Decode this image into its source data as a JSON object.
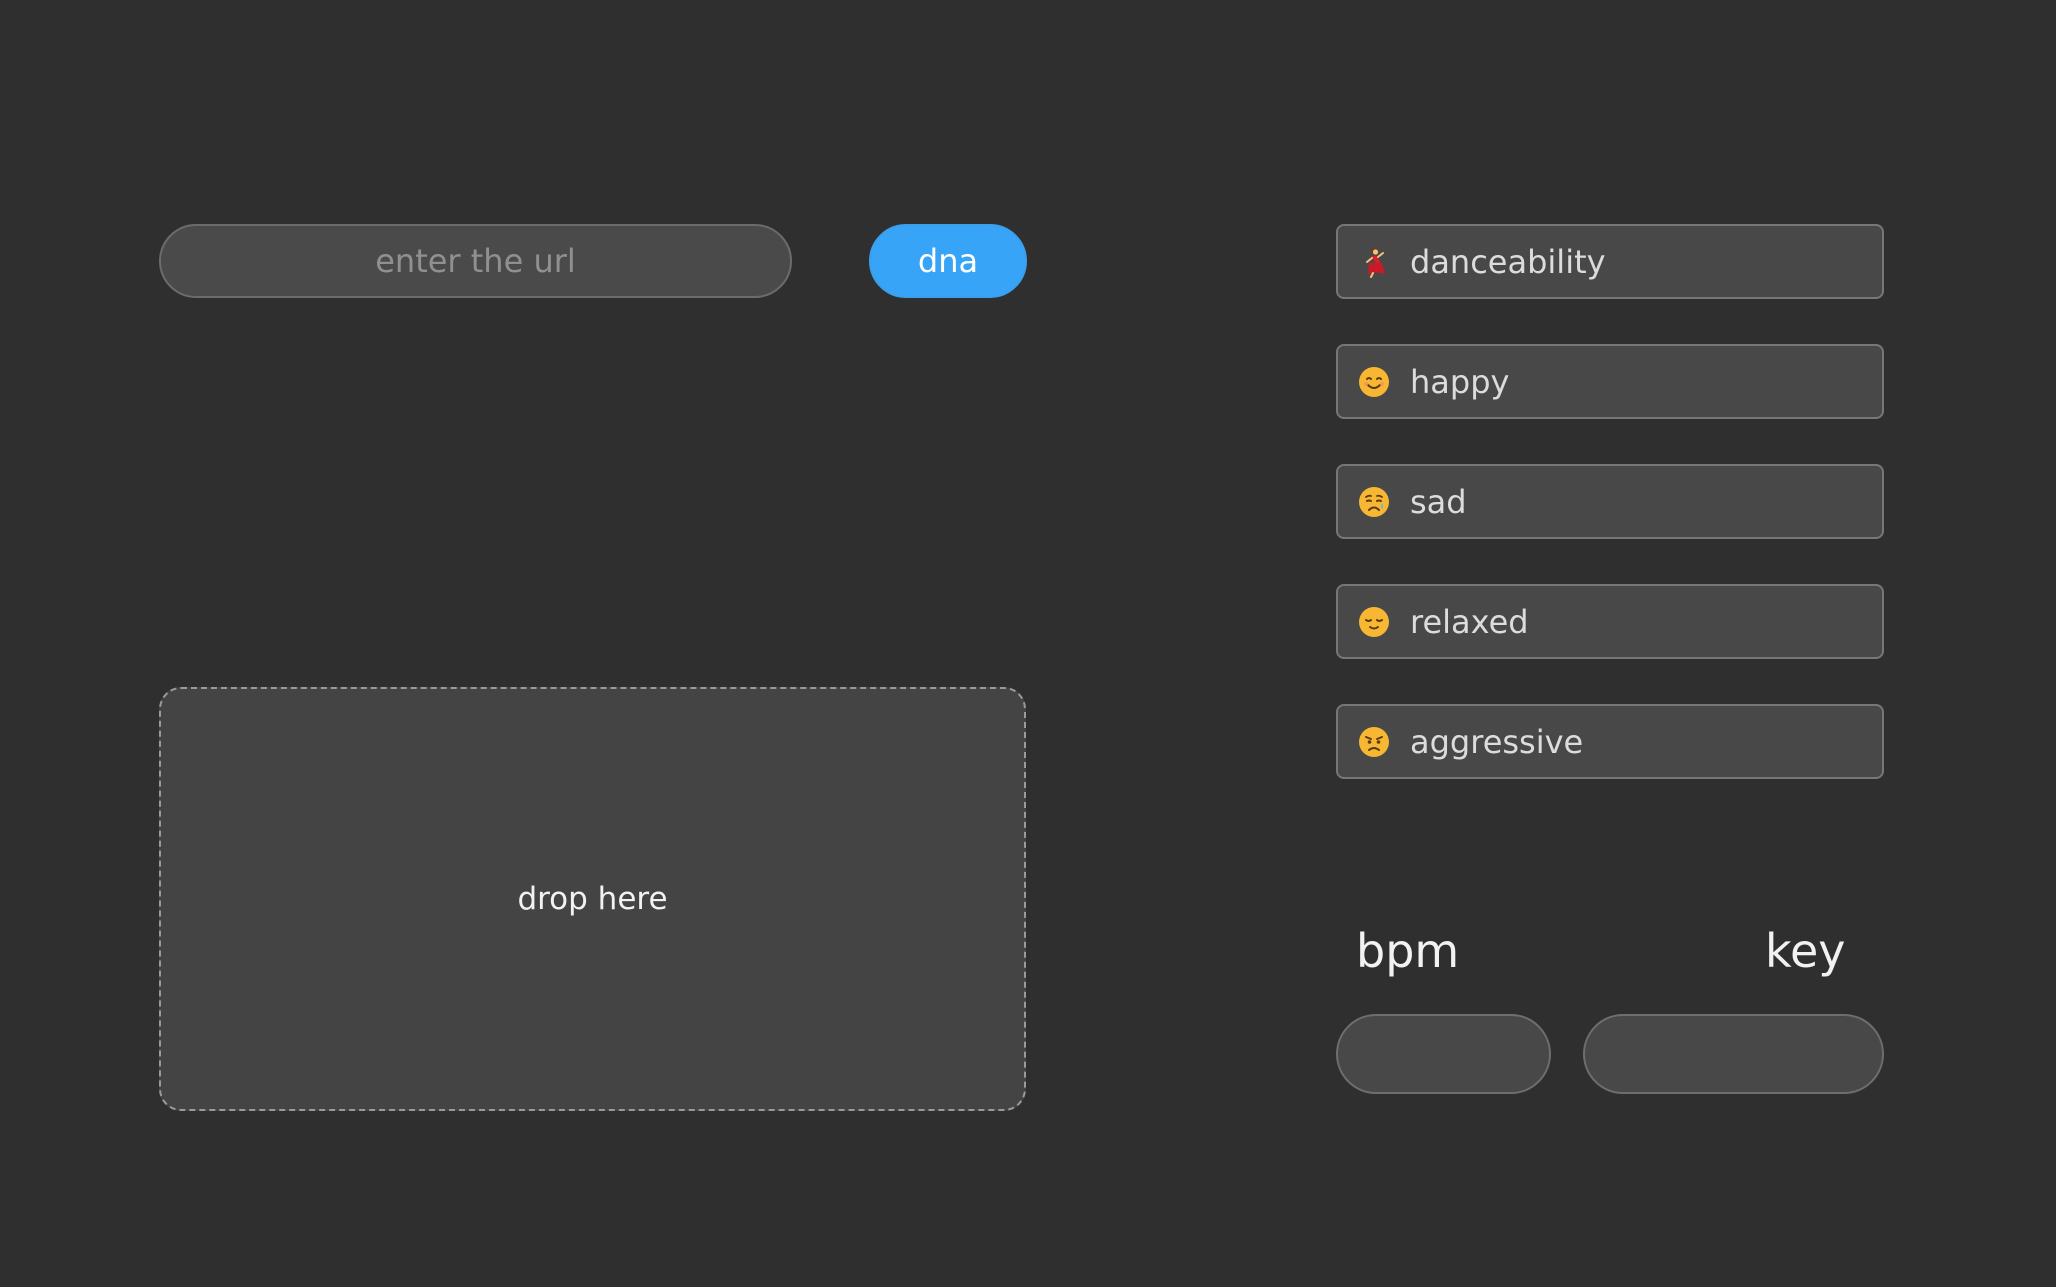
{
  "url_input": {
    "placeholder": "enter the url",
    "value": ""
  },
  "dna_button": {
    "label": "dna",
    "color": "#38a4f8"
  },
  "drop_zone": {
    "label": "drop here"
  },
  "moods": [
    {
      "label": "danceability",
      "icon": "dancer-icon"
    },
    {
      "label": "happy",
      "icon": "smiling-face-icon"
    },
    {
      "label": "sad",
      "icon": "sad-face-icon"
    },
    {
      "label": "relaxed",
      "icon": "relieved-face-icon"
    },
    {
      "label": "aggressive",
      "icon": "angry-face-icon"
    }
  ],
  "bpm": {
    "label": "bpm",
    "value": ""
  },
  "key": {
    "label": "key",
    "value": ""
  },
  "colors": {
    "background": "#2f2f2f",
    "accent": "#38a4f8"
  }
}
